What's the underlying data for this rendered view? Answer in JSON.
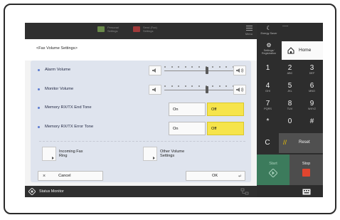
{
  "topbar": {
    "items": [
      {
        "label": "Personal Settings",
        "icon": "personal-settings-icon"
      },
      {
        "label": "Send (Fax) Settings",
        "icon": "fax-settings-icon"
      }
    ],
    "menu_label": "Menu"
  },
  "page_title": "<Fax Volume Settings>",
  "volume_rows": [
    {
      "label": "Alarm Volume",
      "level": 0.6
    },
    {
      "label": "Monitor Volume",
      "level": 0.6
    }
  ],
  "toggle_rows": [
    {
      "label": "Memory RX/TX End Tone",
      "off_option": "On",
      "on_option": "Off",
      "selected": "Off"
    },
    {
      "label": "Memory RX/TX Error Tone",
      "off_option": "On",
      "on_option": "Off",
      "selected": "Off"
    }
  ],
  "options": {
    "incoming_fax_ring": "Incoming Fax\nRing",
    "other_volume_settings": "Other Volume\nSettings"
  },
  "actions": {
    "cancel": "Cancel",
    "ok": "OK"
  },
  "status": {
    "label": "Status Monitor"
  },
  "keypad": {
    "energy_saver": "Energy Saver",
    "settings_registration": "Settings/ Registration",
    "home": "Home",
    "keys": [
      {
        "num": "1",
        "sub": ""
      },
      {
        "num": "2",
        "sub": "ABC"
      },
      {
        "num": "3",
        "sub": "DEF"
      },
      {
        "num": "4",
        "sub": "GHI"
      },
      {
        "num": "5",
        "sub": "JKL"
      },
      {
        "num": "6",
        "sub": "MNO"
      },
      {
        "num": "7",
        "sub": "PQRS"
      },
      {
        "num": "8",
        "sub": "TUV"
      },
      {
        "num": "9",
        "sub": "WXYZ"
      },
      {
        "num": "*",
        "sub": ""
      },
      {
        "num": "0",
        "sub": ""
      },
      {
        "num": "#",
        "sub": ""
      }
    ],
    "clear": "C",
    "reset": "Reset",
    "start": "Start",
    "stop": "Stop",
    "dots": "-----"
  },
  "colors": {
    "accent_yellow": "#f6e44b",
    "start_green": "#3c7b5c",
    "stop_red": "#e0452f",
    "panel": "#dfe4ee"
  }
}
